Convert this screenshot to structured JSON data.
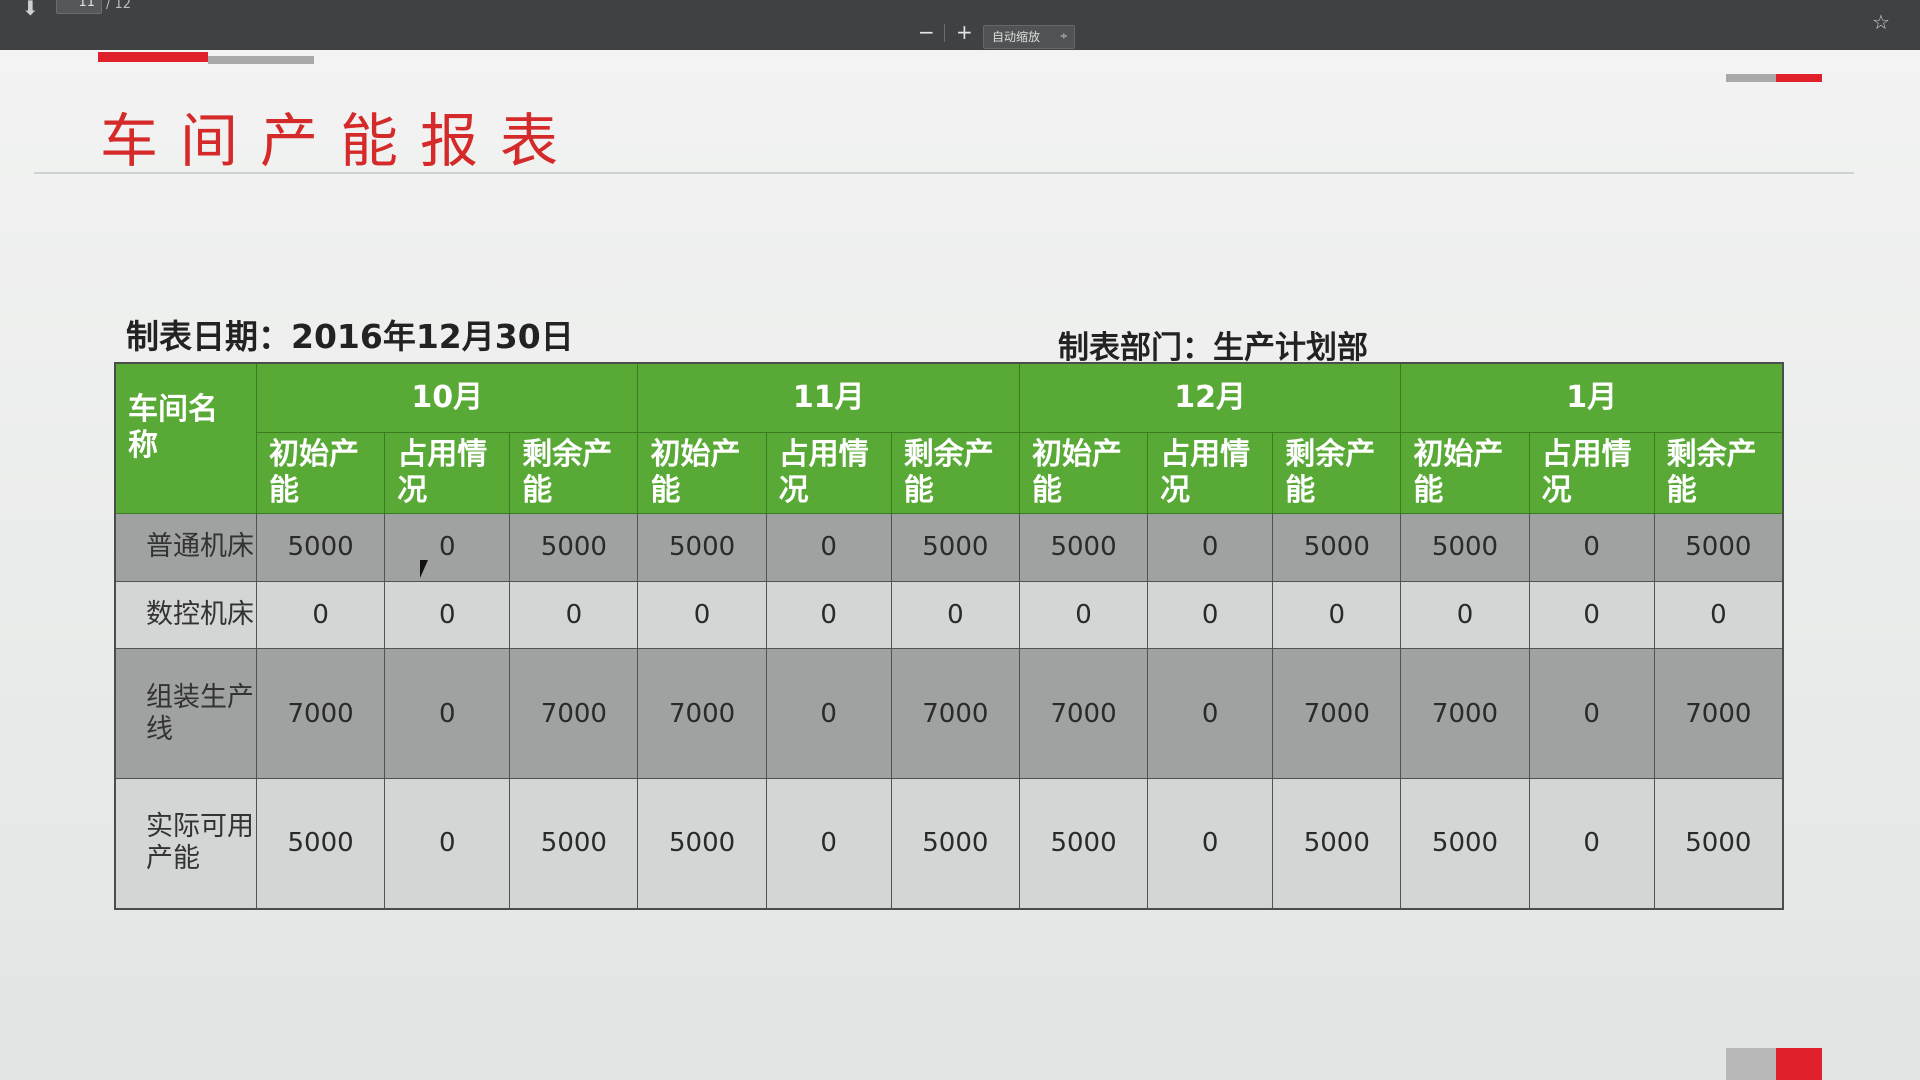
{
  "viewer": {
    "page_current": "11",
    "page_total": "/ 12",
    "zoom_out": "−",
    "zoom_in": "+",
    "zoom_label": "自动缩放",
    "zoom_arrows": "÷",
    "bookmark": "☆",
    "download": "⬇"
  },
  "slide": {
    "title": "车间产能报表",
    "date_label": "制表日期：2016年12月30日",
    "dept_label": "制表部门：生产计划部"
  },
  "table": {
    "name_header": "车间名称",
    "months": [
      "10月",
      "11月",
      "12月",
      "1月"
    ],
    "subheaders": [
      [
        "初始产能",
        "占用情况",
        "剩余产能"
      ],
      [
        "初始产能",
        "占用情况",
        "剩余产能"
      ],
      [
        "初始产能",
        "占用情况",
        "剩余产能"
      ],
      [
        "初始产能",
        "占用情况",
        "剩余产能"
      ]
    ],
    "rows": [
      {
        "name": "普通机床",
        "values": [
          "5000",
          "0",
          "5000",
          "5000",
          "0",
          "5000",
          "5000",
          "0",
          "5000",
          "5000",
          "0",
          "5000"
        ]
      },
      {
        "name": "数控机床",
        "values": [
          "0",
          "0",
          "0",
          "0",
          "0",
          "0",
          "0",
          "0",
          "0",
          "0",
          "0",
          "0"
        ]
      },
      {
        "name": "组装生产线",
        "values": [
          "7000",
          "0",
          "7000",
          "7000",
          "0",
          "7000",
          "7000",
          "0",
          "7000",
          "7000",
          "0",
          "7000"
        ]
      },
      {
        "name": "实际可用产能",
        "values": [
          "5000",
          "0",
          "5000",
          "5000",
          "0",
          "5000",
          "5000",
          "0",
          "5000",
          "5000",
          "0",
          "5000"
        ]
      }
    ]
  },
  "colors": {
    "accent_red": "#e0202a",
    "header_green": "#58a936",
    "title_red": "#d42a2a"
  }
}
